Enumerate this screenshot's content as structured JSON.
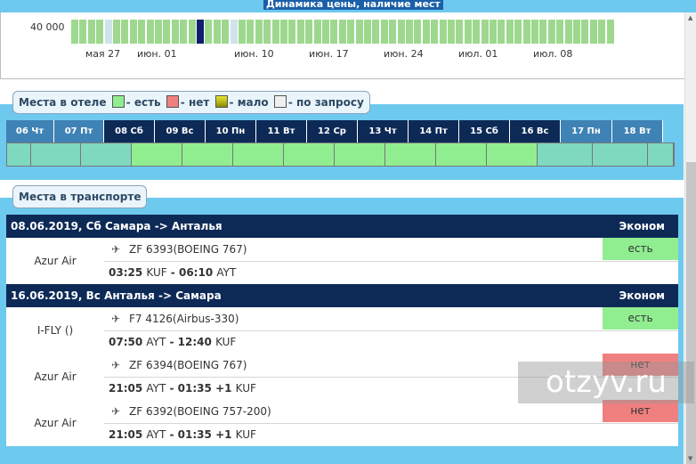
{
  "window": {
    "title": "Динамика цены, наличие мест"
  },
  "price_chart": {
    "y_label": "40 000",
    "date_labels": [
      "мая 27",
      "июн. 01",
      "июн. 10",
      "июн. 17",
      "июн. 24",
      "июл. 01",
      "июл. 08"
    ],
    "bar_status": [
      "g",
      "g",
      "g",
      "g",
      "w",
      "g",
      "g",
      "g",
      "g",
      "g",
      "g",
      "g",
      "g",
      "g",
      "g",
      "g",
      "g",
      "g",
      "g",
      "g",
      "g",
      "g",
      "g",
      "g",
      "g",
      "g",
      "g",
      "g",
      "g",
      "g",
      "g",
      "g",
      "g",
      "g",
      "g",
      "g",
      "g",
      "g",
      "g",
      "g",
      "g",
      "g",
      "g",
      "g",
      "g",
      "g",
      "g",
      "g",
      "g",
      "g",
      "g",
      "g",
      "g",
      "g",
      "g",
      "g",
      "g",
      "g",
      "g",
      "g",
      "g",
      "g",
      "g",
      "g",
      "g"
    ],
    "selected_bar_index": 15,
    "light_bar_indices": [
      4,
      19
    ]
  },
  "hotel": {
    "legend_title": "Места в отеле",
    "legend": [
      {
        "label": "- есть",
        "color": "#90ee90"
      },
      {
        "label": "- нет",
        "color": "#f08080"
      },
      {
        "label": "- мало",
        "color": "#c8c800"
      },
      {
        "label": "- по запросу",
        "color": "#f0f0f0"
      }
    ],
    "days": [
      {
        "label": "06 Чт",
        "active": false
      },
      {
        "label": "07 Пт",
        "active": false
      },
      {
        "label": "08 Сб",
        "active": true
      },
      {
        "label": "09 Вс",
        "active": true
      },
      {
        "label": "10 Пн",
        "active": true
      },
      {
        "label": "11 Вт",
        "active": true
      },
      {
        "label": "12 Ср",
        "active": true
      },
      {
        "label": "13 Чт",
        "active": true
      },
      {
        "label": "14 Пт",
        "active": true
      },
      {
        "label": "15 Сб",
        "active": true
      },
      {
        "label": "16 Вс",
        "active": true
      },
      {
        "label": "17 Пн",
        "active": false
      },
      {
        "label": "18 Вт",
        "active": false
      }
    ]
  },
  "transport": {
    "legend_title": "Места в транспорте",
    "trips": [
      {
        "route": "08.06.2019, Сб Самара -> Анталья",
        "class": "Эконом",
        "flights": [
          {
            "airline": "Azur Air",
            "flight": "ZF 6393(BOEING 767)",
            "dep_time": "03:25",
            "dep_code": "KUF",
            "arr_time": "06:10",
            "arr_code": "AYT",
            "plus": "",
            "status": "есть",
            "status_color": "#90ee90"
          }
        ]
      },
      {
        "route": "16.06.2019, Вс Анталья -> Самара",
        "class": "Эконом",
        "flights": [
          {
            "airline": "I-FLY ()",
            "flight": "F7 4126(Airbus-330)",
            "dep_time": "07:50",
            "dep_code": "AYT",
            "arr_time": "12:40",
            "arr_code": "KUF",
            "plus": "",
            "status": "есть",
            "status_color": "#90ee90"
          },
          {
            "airline": "Azur Air",
            "flight": "ZF 6394(BOEING 767)",
            "dep_time": "21:05",
            "dep_code": "AYT",
            "arr_time": "01:35",
            "arr_code": "KUF",
            "plus": "+1",
            "status": "нет",
            "status_color": "#f08080"
          },
          {
            "airline": "Azur Air",
            "flight": "ZF 6392(BOEING 757-200)",
            "dep_time": "21:05",
            "dep_code": "AYT",
            "arr_time": "01:35",
            "arr_code": "KUF",
            "plus": "+1",
            "status": "нет",
            "status_color": "#f08080"
          }
        ]
      }
    ]
  },
  "watermark": {
    "text": "otzyv.ru"
  },
  "colors": {
    "panel": "#6ec9ee",
    "header_dark": "#0d2a57",
    "header_active": "#0d2a57",
    "header_inactive": "#3f82b5",
    "cell_active": "#90ee90",
    "cell_inactive": "#7fd9bf"
  }
}
